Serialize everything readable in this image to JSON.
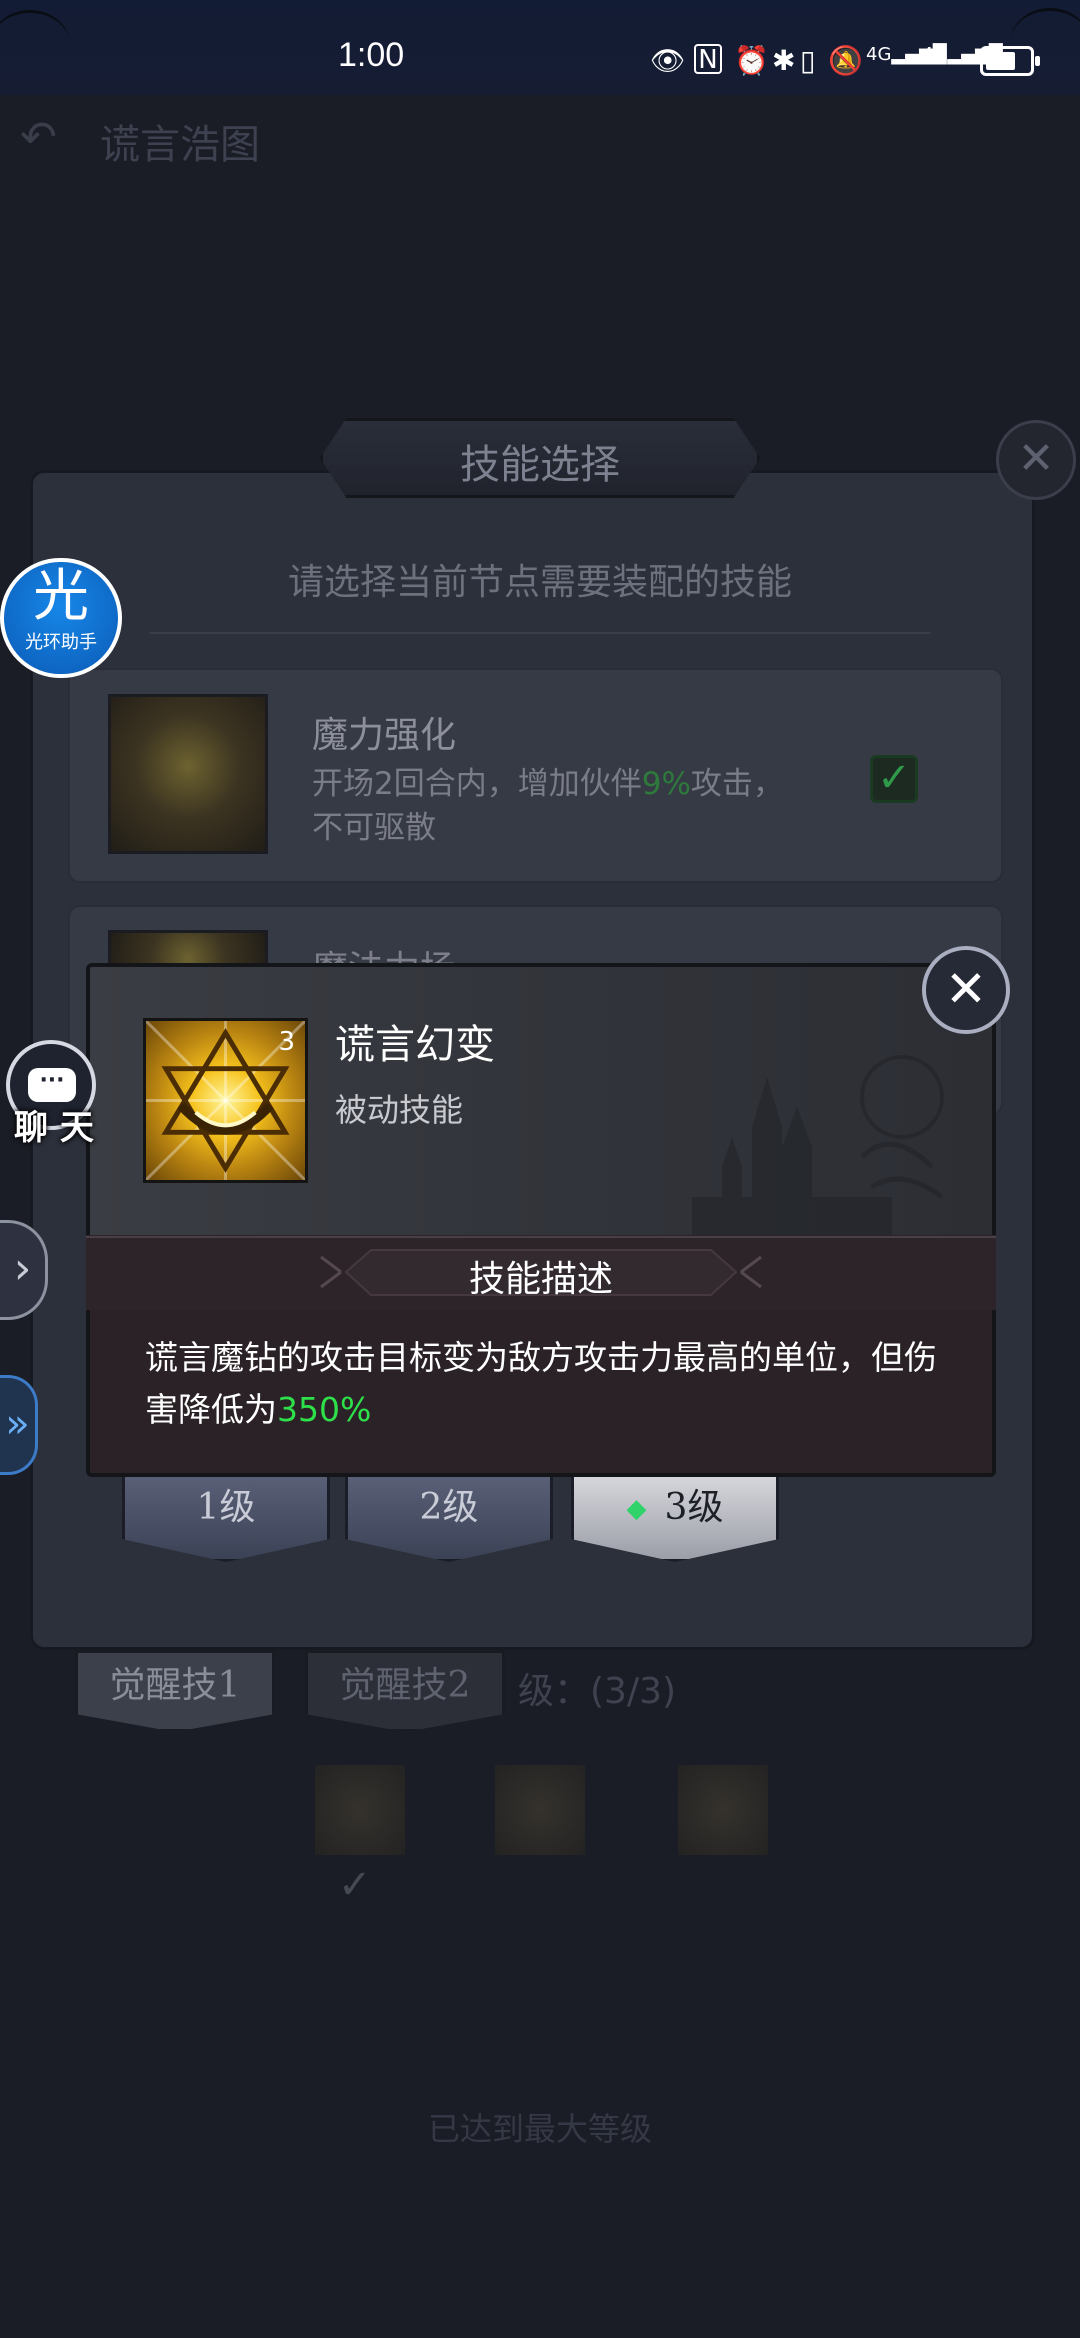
{
  "status_bar": {
    "time": "1:00",
    "icons": [
      "eye-icon",
      "nfc-icon",
      "alarm-icon",
      "bluetooth-icon",
      "vibrate-icon",
      "mute-icon",
      "signal-4g-icon",
      "signal-4g-icon"
    ],
    "signal1_label": "4G",
    "signal2_label": "4G",
    "battery_level": 0.7
  },
  "background_page": {
    "title": "谎言浩图"
  },
  "skill_select": {
    "title": "技能选择",
    "subtitle": "请选择当前节点需要装配的技能",
    "skills": [
      {
        "name": "魔力强化",
        "desc_part1": "开场2回合内，增加伙伴",
        "desc_pct": "9%",
        "desc_part2": "攻击，不可驱散",
        "selected": true
      },
      {
        "name": "魔法力场"
      }
    ],
    "levels": [
      "1级",
      "2级",
      "3级"
    ],
    "selected_level_index": 2
  },
  "popup": {
    "skill_name": "谎言幻变",
    "skill_type": "被动技能",
    "icon_level": "3",
    "desc_title": "技能描述",
    "desc_text": "谎言魔钻的攻击目标变为敌方攻击力最高的单位，但伤害降低为",
    "desc_highlight": "350%",
    "highlight_color": "#2ee04a"
  },
  "awakening": {
    "tab1": "觉醒技1",
    "tab2": "觉醒技2",
    "level_text": "级：(3/3)",
    "maxed_text": "已达到最大等级"
  },
  "overlays": {
    "helper_glyph": "光",
    "helper_label": "光环助手",
    "chat_label": "聊 天"
  }
}
